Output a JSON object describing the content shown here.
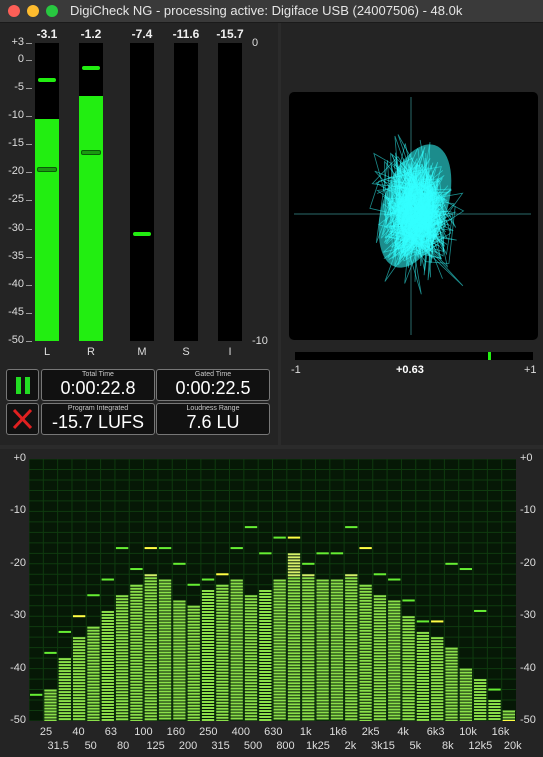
{
  "window": {
    "title": "DigiCheck NG - processing active: Digiface USB (24007506) - 48.0k",
    "traffic_lights": {
      "close": "#fd5f57",
      "minimize": "#febc2e",
      "zoom": "#28c840"
    }
  },
  "level_meters": {
    "scale_left": [
      "+3",
      "0",
      "-5",
      "-10",
      "-15",
      "-20",
      "-25",
      "-30",
      "-35",
      "-40",
      "-45",
      "-50"
    ],
    "scale_right_top": "0",
    "scale_right_bottom": "-10",
    "channels": [
      {
        "label": "L",
        "value": "-3.1",
        "level_db": -10.5,
        "peak_db": -3.5,
        "rms_db": -19
      },
      {
        "label": "R",
        "value": "-1.2",
        "level_db": -6.5,
        "peak_db": -1.5,
        "rms_db": -16
      },
      {
        "label": "M",
        "value": "-7.4",
        "level_db": null,
        "peak_db": -31,
        "rms_db": null
      },
      {
        "label": "S",
        "value": "-11.6",
        "level_db": null,
        "peak_db": null,
        "rms_db": null
      },
      {
        "label": "I",
        "value": "-15.7",
        "level_db": null,
        "peak_db": null,
        "rms_db": null
      }
    ]
  },
  "loudness": {
    "pause_icon": "pause-icon",
    "reset_icon": "close-icon",
    "total_time_caption": "Total Time",
    "total_time": "0:00:22.8",
    "gated_time_caption": "Gated Time",
    "gated_time": "0:00:22.5",
    "program_caption": "Program Integrated",
    "program_value": "-15.7 LUFS",
    "range_caption": "Loudness Range",
    "range_value": "7.6 LU"
  },
  "correlation": {
    "min_label": "-1",
    "value_label": "+0.63",
    "max_label": "+1",
    "value": 0.63
  },
  "spectrum": {
    "y_labels": [
      "+0",
      "-10",
      "-20",
      "-30",
      "-40",
      "-50"
    ],
    "top_labels": [
      "25",
      "40",
      "63",
      "100",
      "160",
      "250",
      "400",
      "630",
      "1k",
      "1k6",
      "2k5",
      "4k",
      "6k3",
      "10k",
      "16k"
    ],
    "bottom_labels": [
      "31.5",
      "50",
      "80",
      "125",
      "200",
      "315",
      "500",
      "800",
      "1k25",
      "2k",
      "3k15",
      "5k",
      "8k",
      "12k5",
      "20k"
    ],
    "bands_db": [
      -50,
      -44,
      -38,
      -34,
      -32,
      -29,
      -26,
      -24,
      -22,
      -23,
      -27,
      -28,
      -25,
      -24,
      -23,
      -26,
      -25,
      -23,
      -18,
      -22,
      -23,
      -23,
      -22,
      -24,
      -26,
      -27,
      -30,
      -33,
      -34,
      -36,
      -40,
      -42,
      -46,
      -48
    ],
    "peaks_db": [
      -45,
      -37,
      -33,
      -30,
      -26,
      -23,
      -17,
      -21,
      -17,
      -17,
      -20,
      -24,
      -23,
      -22,
      -17,
      -13,
      -18,
      -15,
      -15,
      -20,
      -18,
      -18,
      -13,
      -17,
      -22,
      -23,
      -27,
      -31,
      -31,
      -20,
      -21,
      -29,
      -44,
      -50
    ]
  }
}
